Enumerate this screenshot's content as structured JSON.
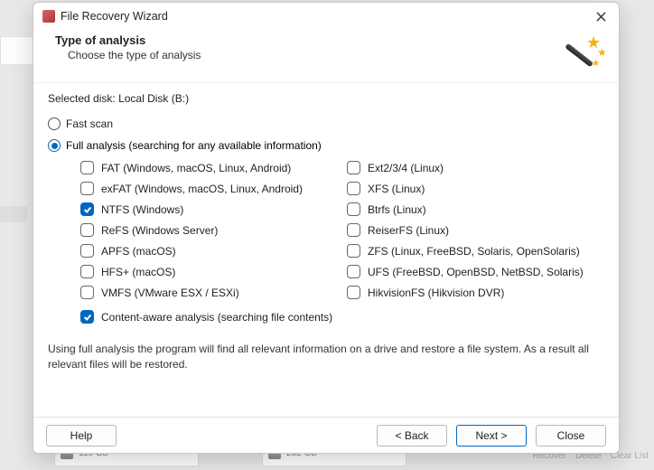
{
  "window": {
    "title": "File Recovery Wizard"
  },
  "header": {
    "title": "Type of analysis",
    "subtitle": "Choose the type of analysis"
  },
  "selected_disk_label": "Selected disk:",
  "selected_disk_value": "Local Disk (B:)",
  "radios": {
    "fast": {
      "label": "Fast scan",
      "selected": false
    },
    "full": {
      "label": "Full analysis (searching for any available information)",
      "selected": true
    }
  },
  "filesystems_left": [
    {
      "id": "fat",
      "label": "FAT (Windows, macOS, Linux, Android)",
      "checked": false
    },
    {
      "id": "exfat",
      "label": "exFAT (Windows, macOS, Linux, Android)",
      "checked": false
    },
    {
      "id": "ntfs",
      "label": "NTFS (Windows)",
      "checked": true
    },
    {
      "id": "refs",
      "label": "ReFS (Windows Server)",
      "checked": false
    },
    {
      "id": "apfs",
      "label": "APFS (macOS)",
      "checked": false
    },
    {
      "id": "hfs",
      "label": "HFS+ (macOS)",
      "checked": false
    },
    {
      "id": "vmfs",
      "label": "VMFS (VMware ESX / ESXi)",
      "checked": false
    }
  ],
  "filesystems_right": [
    {
      "id": "ext",
      "label": "Ext2/3/4 (Linux)",
      "checked": false
    },
    {
      "id": "xfs",
      "label": "XFS (Linux)",
      "checked": false
    },
    {
      "id": "btrfs",
      "label": "Btrfs (Linux)",
      "checked": false
    },
    {
      "id": "reiserfs",
      "label": "ReiserFS (Linux)",
      "checked": false
    },
    {
      "id": "zfs",
      "label": "ZFS (Linux, FreeBSD, Solaris, OpenSolaris)",
      "checked": false
    },
    {
      "id": "ufs",
      "label": "UFS (FreeBSD, OpenBSD, NetBSD, Solaris)",
      "checked": false
    },
    {
      "id": "hikfs",
      "label": "HikvisionFS (Hikvision DVR)",
      "checked": false
    }
  ],
  "content_aware": {
    "label": "Content-aware analysis (searching file contents)",
    "checked": true
  },
  "hint": "Using full analysis the program will find all relevant information on a drive and restore a file system. As a result all relevant files will be restored.",
  "buttons": {
    "help": "Help",
    "back": "< Back",
    "next": "Next >",
    "close": "Close"
  },
  "background": {
    "card1_size": "119 GB",
    "card2_size": "232 GB",
    "actions": [
      "Recover",
      "Delete",
      "Clear List"
    ]
  }
}
